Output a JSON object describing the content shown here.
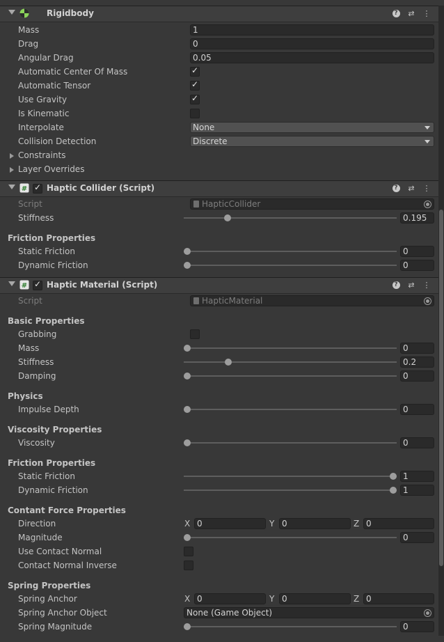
{
  "rigidbody": {
    "title": "Rigidbody",
    "mass_label": "Mass",
    "mass": "1",
    "drag_label": "Drag",
    "drag": "0",
    "angular_drag_label": "Angular Drag",
    "angular_drag": "0.05",
    "auto_com_label": "Automatic Center Of Mass",
    "auto_com": true,
    "auto_tensor_label": "Automatic Tensor",
    "auto_tensor": true,
    "use_gravity_label": "Use Gravity",
    "use_gravity": true,
    "is_kinematic_label": "Is Kinematic",
    "is_kinematic": false,
    "interpolate_label": "Interpolate",
    "interpolate": "None",
    "collision_label": "Collision Detection",
    "collision": "Discrete",
    "constraints_label": "Constraints",
    "layer_overrides_label": "Layer Overrides"
  },
  "haptic_collider": {
    "title": "Haptic Collider (Script)",
    "script_label": "Script",
    "script": "HapticCollider",
    "stiffness_label": "Stiffness",
    "stiffness": "0.195",
    "stiffness_fraction": 0.195,
    "friction_section": "Friction Properties",
    "static_friction_label": "Static Friction",
    "static_friction": "0",
    "dynamic_friction_label": "Dynamic Friction",
    "dynamic_friction": "0"
  },
  "haptic_material": {
    "title": "Haptic Material (Script)",
    "script_label": "Script",
    "script": "HapticMaterial",
    "basic_section": "Basic Properties",
    "grabbing_label": "Grabbing",
    "grabbing": false,
    "mass_label": "Mass",
    "mass": "0",
    "stiffness_label": "Stiffness",
    "stiffness": "0.2",
    "stiffness_fraction": 0.2,
    "damping_label": "Damping",
    "damping": "0",
    "physics_section": "Physics",
    "impulse_label": "Impulse Depth",
    "impulse": "0",
    "viscosity_section": "Viscosity Properties",
    "viscosity_label": "Viscosity",
    "viscosity": "0",
    "friction_section": "Friction Properties",
    "static_friction_label": "Static Friction",
    "static_friction": "1",
    "dynamic_friction_label": "Dynamic Friction",
    "dynamic_friction": "1",
    "contact_section": "Contant Force Properties",
    "direction_label": "Direction",
    "direction_x": "0",
    "direction_y": "0",
    "direction_z": "0",
    "magnitude_label": "Magnitude",
    "magnitude": "0",
    "use_contact_normal_label": "Use Contact Normal",
    "contact_normal_inverse_label": "Contact Normal Inverse",
    "spring_section": "Spring Properties",
    "spring_anchor_label": "Spring Anchor",
    "spring_anchor_x": "0",
    "spring_anchor_y": "0",
    "spring_anchor_z": "0",
    "spring_anchor_object_label": "Spring Anchor Object",
    "spring_anchor_object": "None (Game Object)",
    "spring_magnitude_label": "Spring Magnitude",
    "spring_magnitude": "0"
  },
  "axes": {
    "x": "X",
    "y": "Y",
    "z": "Z"
  },
  "colors": {
    "panel": "#383838",
    "field": "#2a2a2a",
    "header": "#3e3e3e"
  }
}
